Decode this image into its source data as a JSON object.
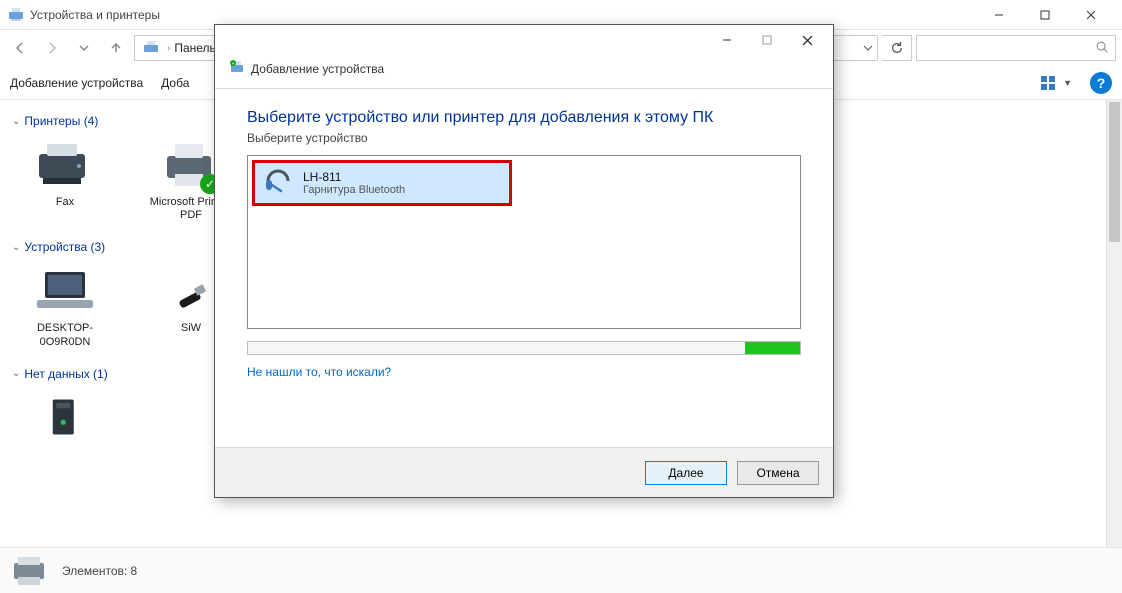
{
  "window": {
    "title": "Устройства и принтеры"
  },
  "breadcrumb": {
    "segment1": "Панель упр"
  },
  "toolbar": {
    "add_device": "Добавление устройства",
    "add_printer_prefix": "Доба"
  },
  "groups": {
    "printers": {
      "header": "Принтеры (4)"
    },
    "devices": {
      "header": "Устройства (3)"
    },
    "nodata": {
      "header": "Нет данных (1)"
    }
  },
  "printers": [
    {
      "label": "Fax"
    },
    {
      "label": "Microsoft Print to PDF"
    }
  ],
  "devices": [
    {
      "label": "DESKTOP-0O9R0DN"
    },
    {
      "label": "SiW"
    }
  ],
  "statusbar": {
    "text": "Элементов: 8"
  },
  "modal": {
    "window_title": "",
    "sub_title": "Добавление устройства",
    "heading": "Выберите устройство или принтер для добавления к этому ПК",
    "hint": "Выберите устройство",
    "device": {
      "name": "LH-811",
      "type": "Гарнитура Bluetooth"
    },
    "help_link": "Не нашли то, что искали?",
    "next": "Далее",
    "cancel": "Отмена"
  }
}
